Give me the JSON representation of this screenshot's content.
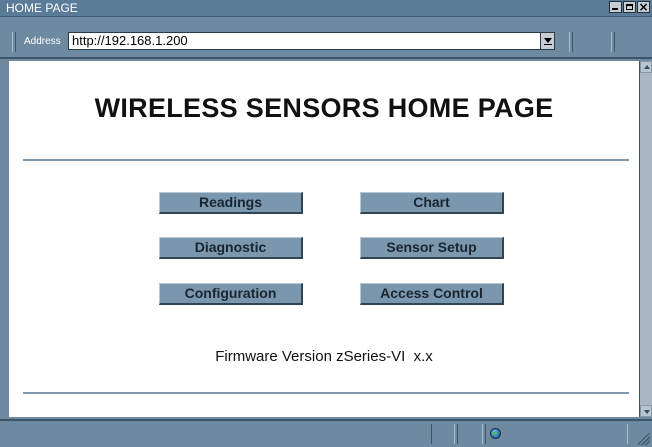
{
  "window": {
    "title": "HOME PAGE"
  },
  "toolbar": {
    "address_label": "Address",
    "address_value": "http://192.168.1.200"
  },
  "page": {
    "heading": "WIRELESS SENSORS HOME PAGE",
    "buttons": {
      "readings": "Readings",
      "chart": "Chart",
      "diagnostic": "Diagnostic",
      "sensor_setup": "Sensor Setup",
      "configuration": "Configuration",
      "access_control": "Access Control"
    },
    "firmware": "Firmware Version zSeries-VI  x.x"
  },
  "colors": {
    "chrome": "#6e8aa0",
    "button_face": "#7a97ae",
    "rule": "#7f98ad"
  },
  "icons": {
    "status_zone": "globe-icon"
  }
}
